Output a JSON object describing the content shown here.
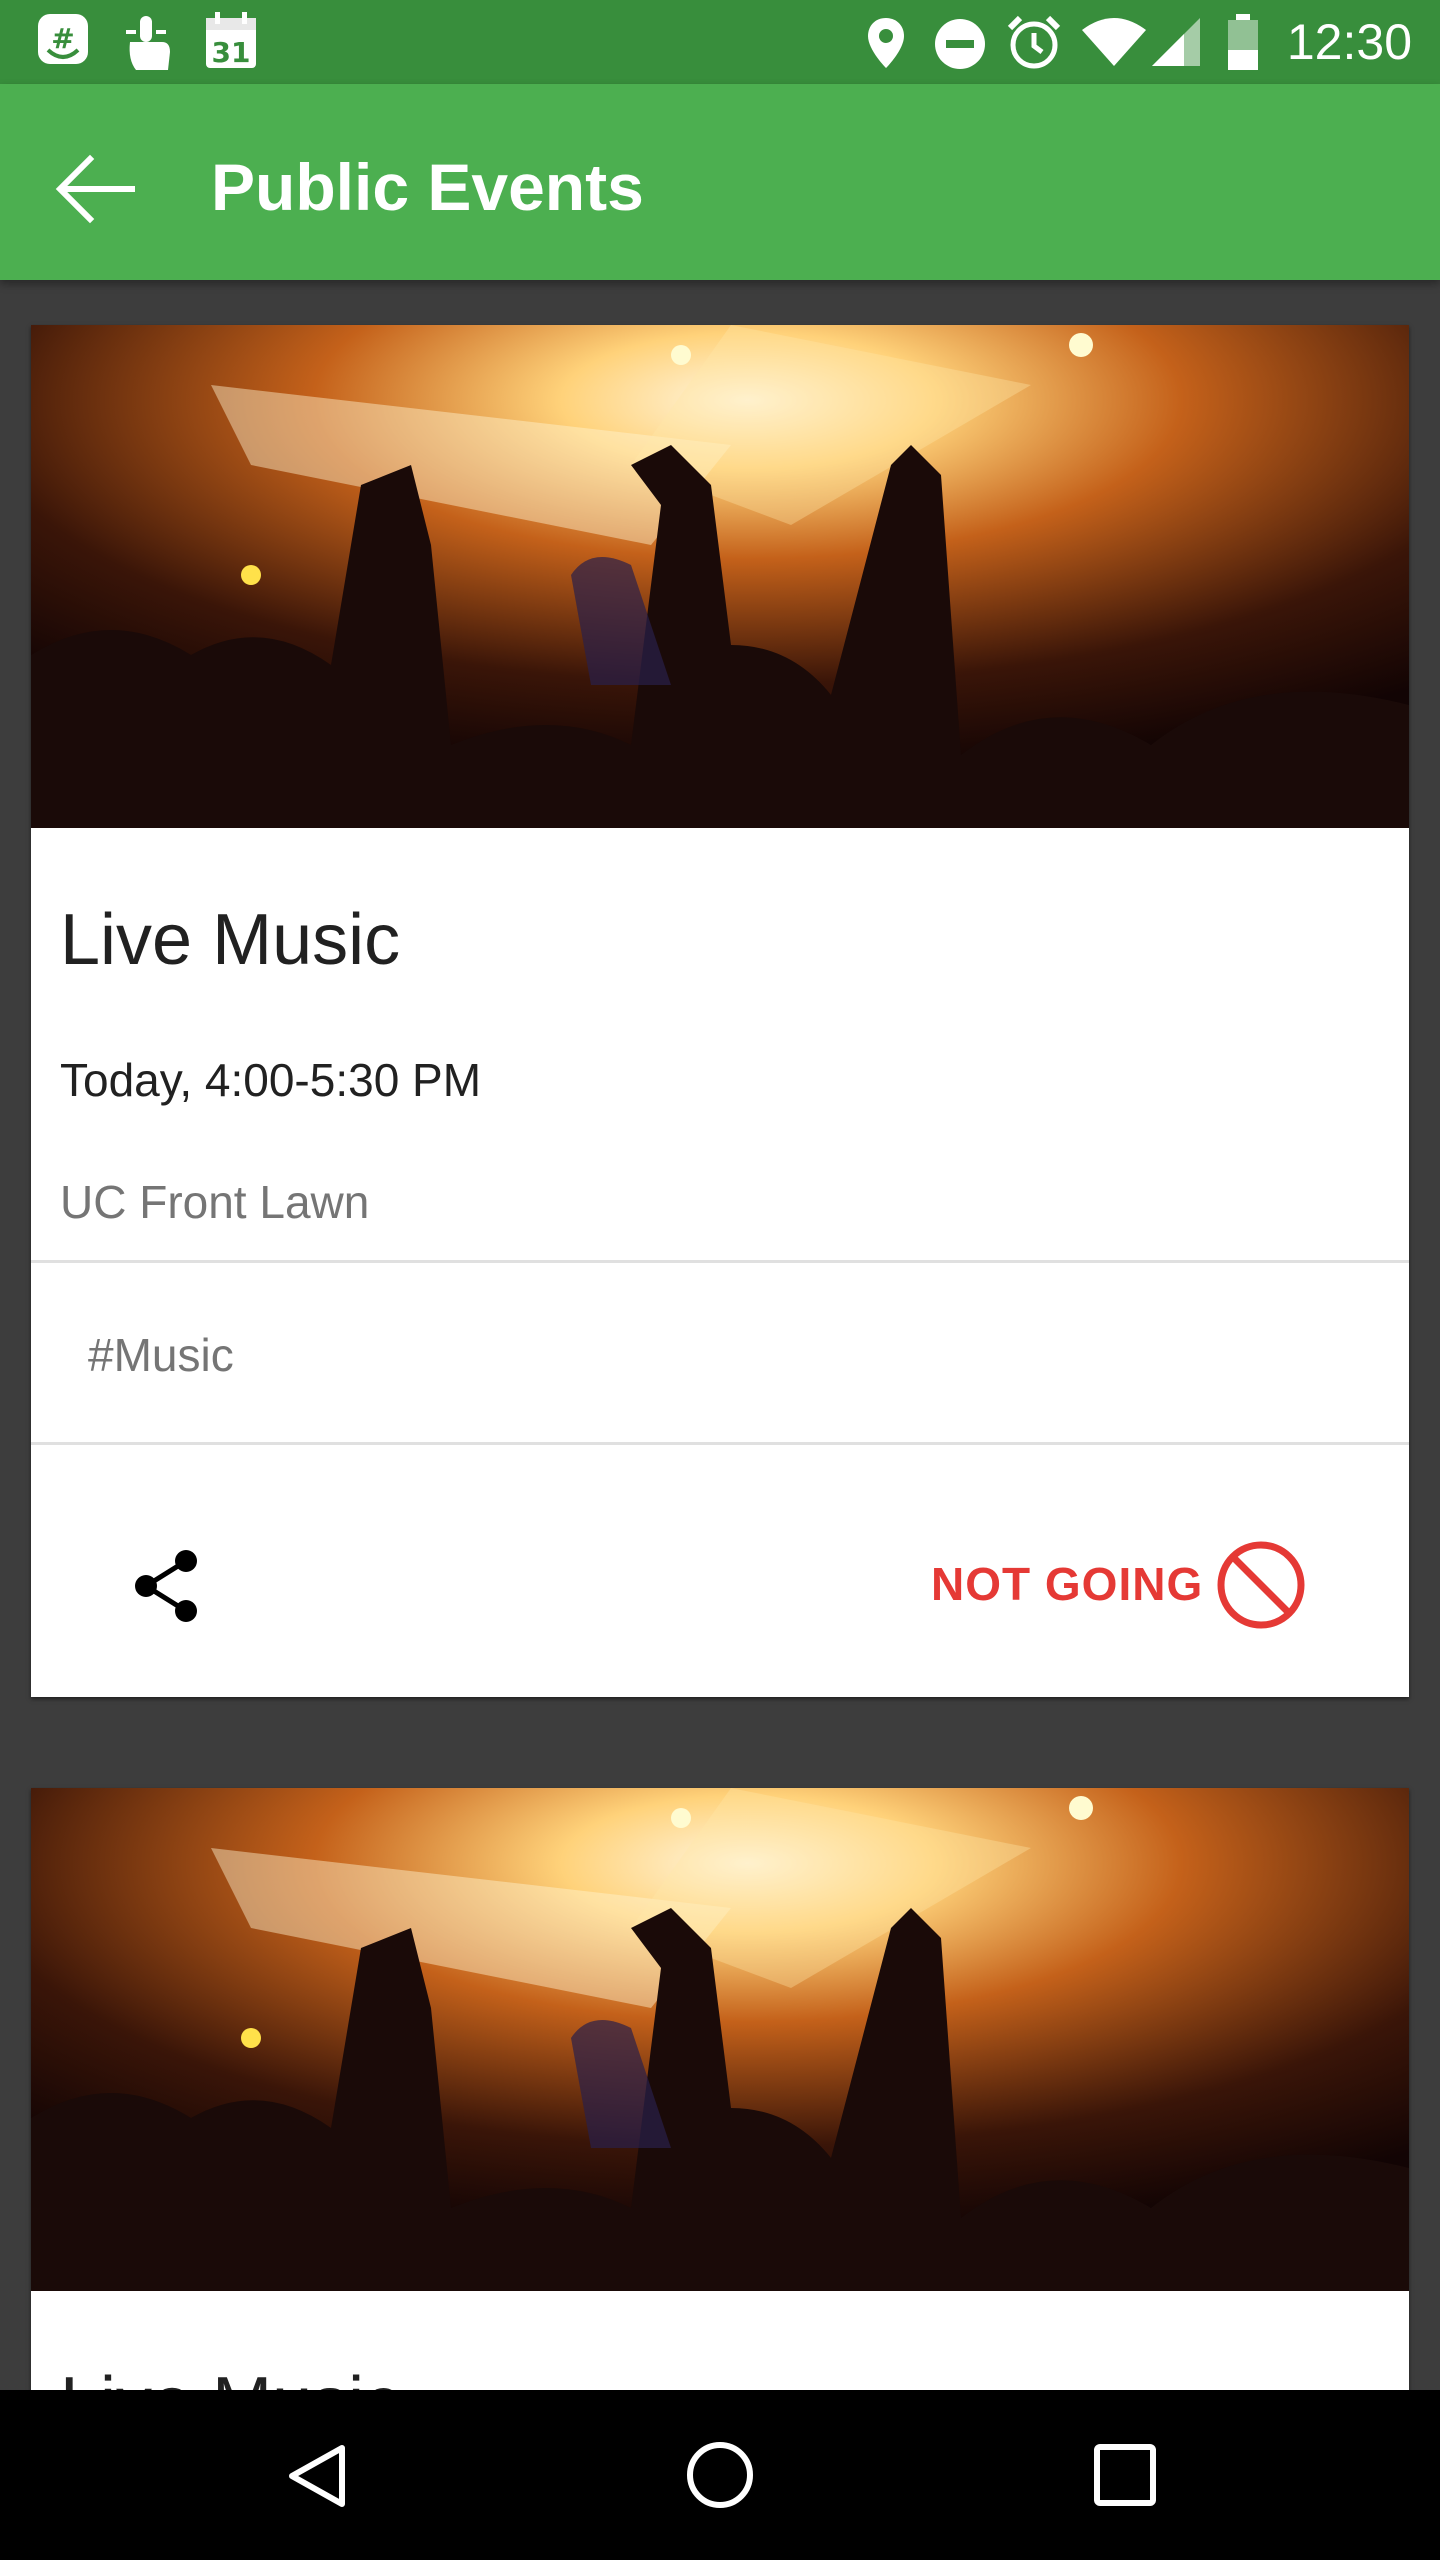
{
  "status_bar": {
    "time": "12:30",
    "left_icons": [
      "notification-app-icon",
      "touch-icon",
      "calendar-icon"
    ],
    "calendar_day": "31",
    "right_icons": [
      "location-icon",
      "do-not-disturb-icon",
      "alarm-icon",
      "wifi-icon",
      "signal-icon",
      "battery-icon"
    ]
  },
  "app_bar": {
    "title": "Public Events",
    "back_icon": "arrow-back-icon"
  },
  "events": [
    {
      "title": "Live Music",
      "time": "Today, 4:00-5:30 PM",
      "location": "UC Front Lawn",
      "tag": "#Music",
      "status_label": "NOT GOING",
      "share_icon": "share-icon",
      "status_icon": "block-icon"
    },
    {
      "title": "Live Music"
    }
  ],
  "nav_bar": {
    "buttons": [
      "back-triangle-icon",
      "home-circle-icon",
      "recents-square-icon"
    ]
  },
  "colors": {
    "status_bar": "#388e3c",
    "app_bar": "#4caf50",
    "background": "#3d3d3d",
    "accent_red": "#e53935"
  }
}
